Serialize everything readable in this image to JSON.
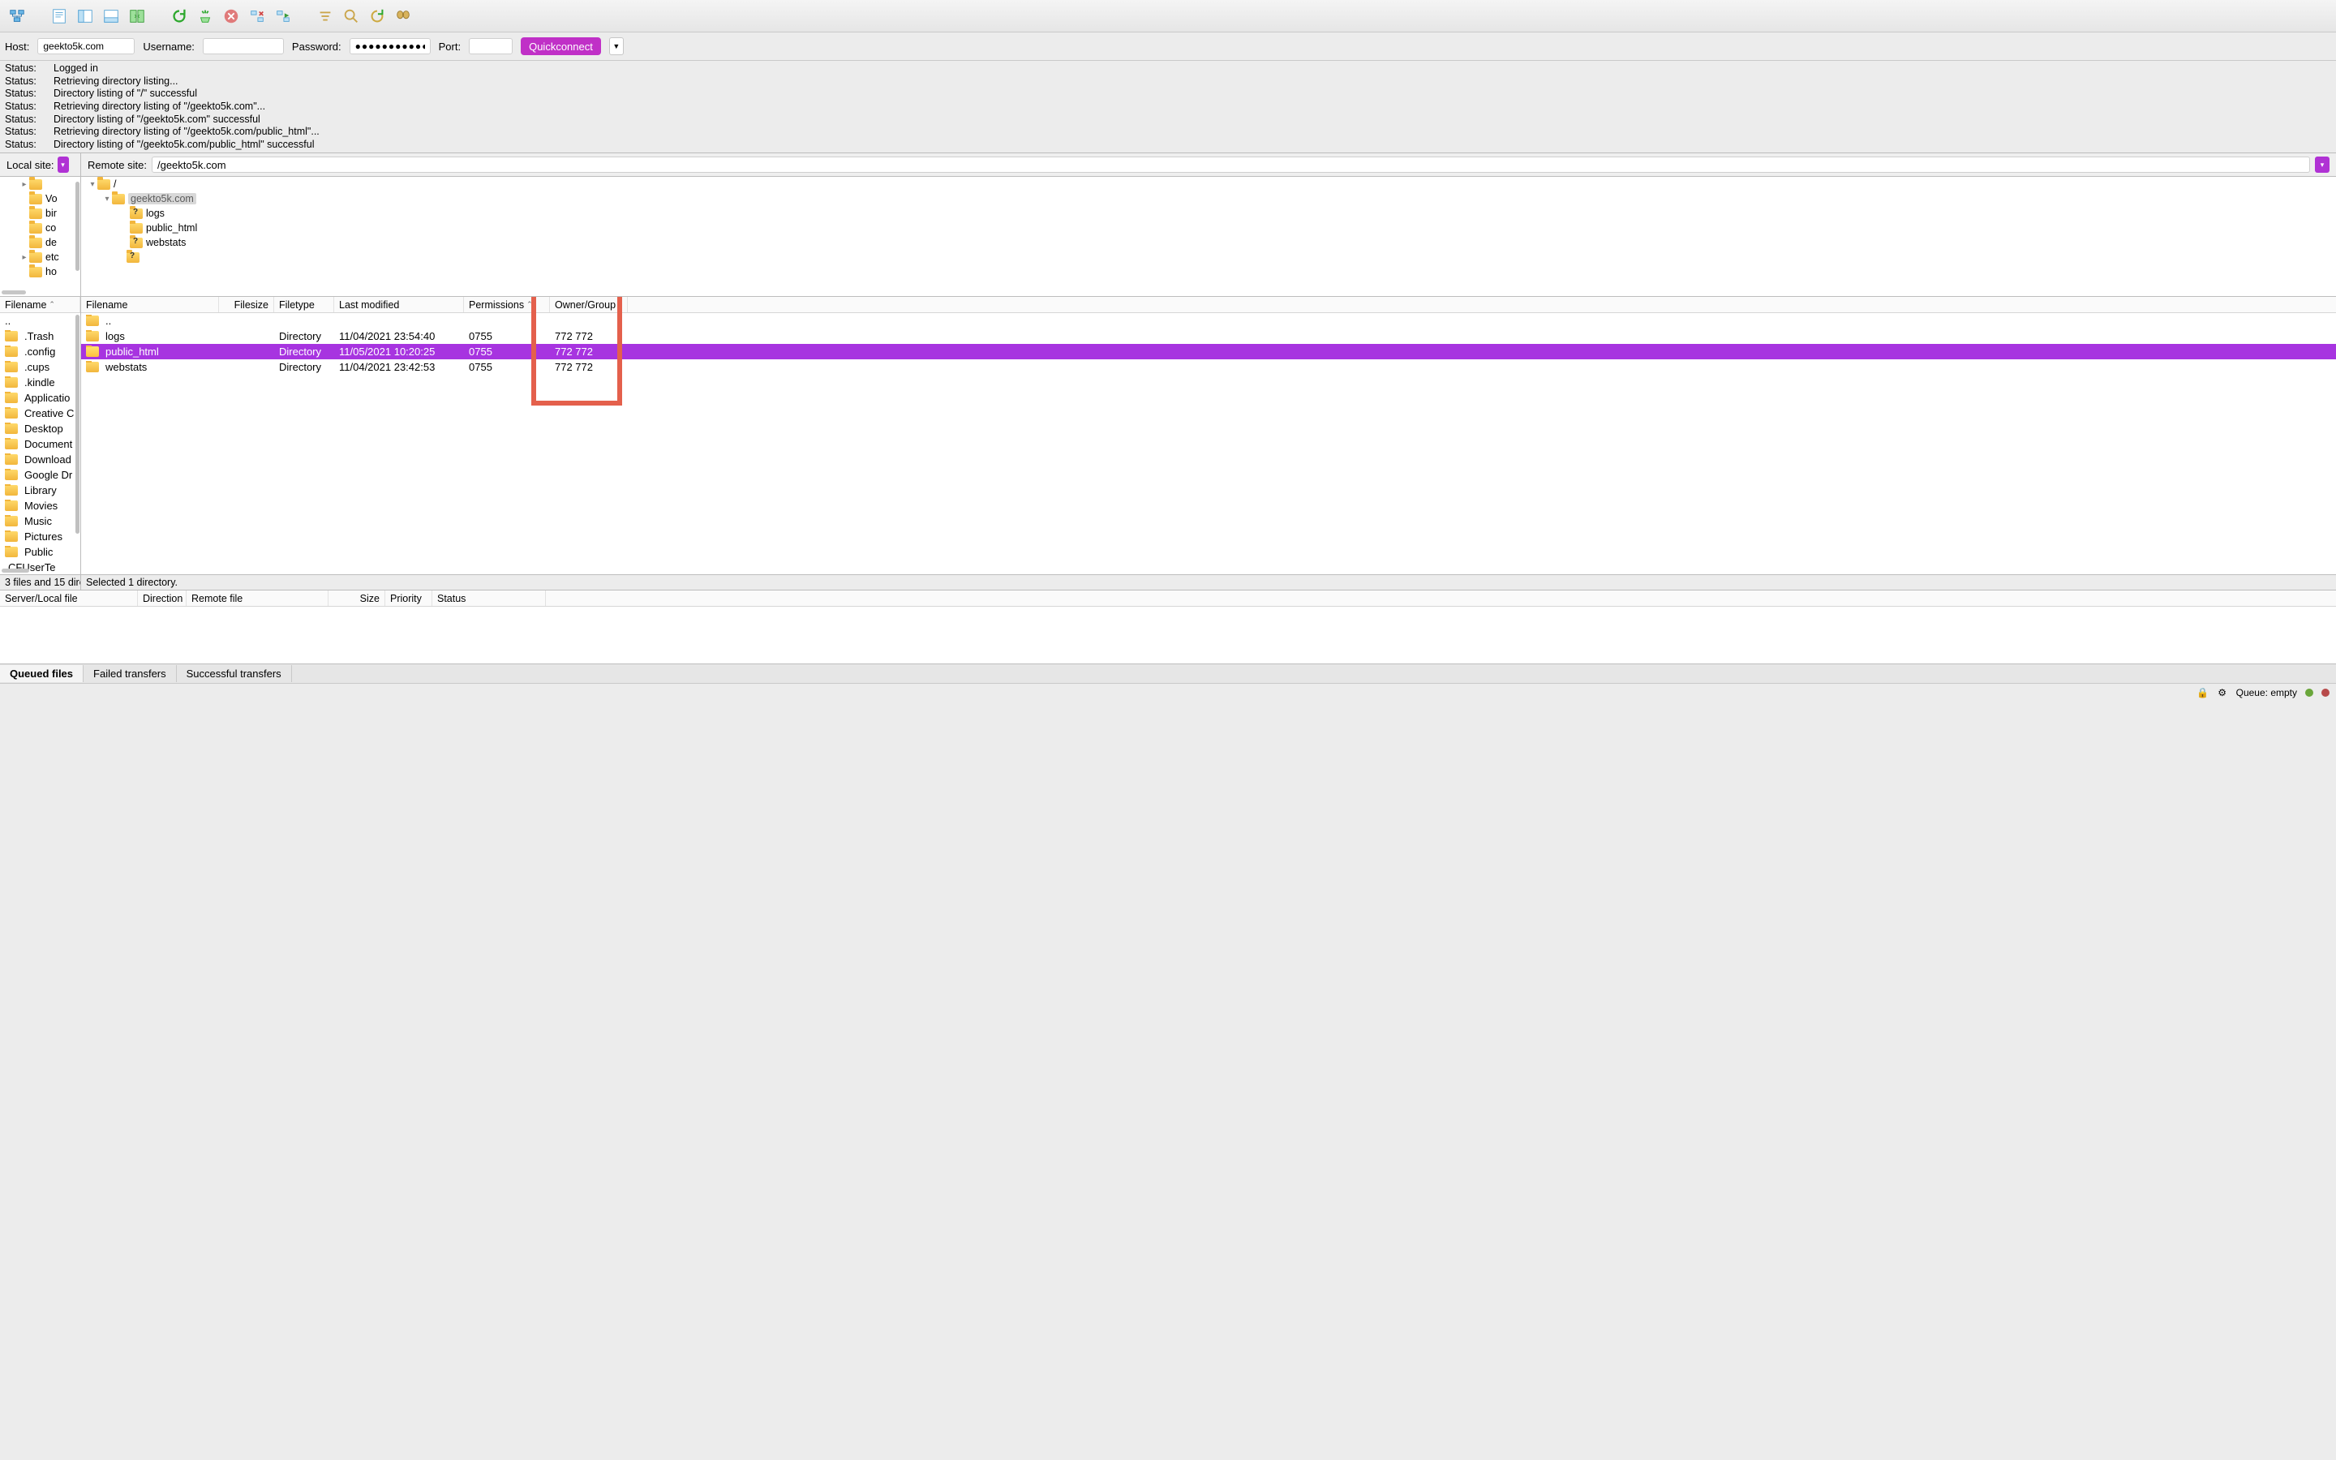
{
  "connectbar": {
    "host_label": "Host:",
    "host_value": "geekto5k.com",
    "user_label": "Username:",
    "user_value": "",
    "pass_label": "Password:",
    "pass_value": "●●●●●●●●●●●",
    "port_label": "Port:",
    "port_value": "",
    "button": "Quickconnect"
  },
  "log": [
    {
      "label": "Status:",
      "msg": "Logged in"
    },
    {
      "label": "Status:",
      "msg": "Retrieving directory listing..."
    },
    {
      "label": "Status:",
      "msg": "Directory listing of \"/\" successful"
    },
    {
      "label": "Status:",
      "msg": "Retrieving directory listing of \"/geekto5k.com\"..."
    },
    {
      "label": "Status:",
      "msg": "Directory listing of \"/geekto5k.com\" successful"
    },
    {
      "label": "Status:",
      "msg": "Retrieving directory listing of \"/geekto5k.com/public_html\"..."
    },
    {
      "label": "Status:",
      "msg": "Directory listing of \"/geekto5k.com/public_html\" successful"
    }
  ],
  "sitebar": {
    "local_label": "Local site:",
    "remote_label": "Remote site:",
    "remote_path": "/geekto5k.com"
  },
  "local_tree": [
    {
      "indent": 24,
      "tw": "▸",
      "name": ""
    },
    {
      "indent": 24,
      "tw": "",
      "name": "Vo"
    },
    {
      "indent": 24,
      "tw": "",
      "name": "bir"
    },
    {
      "indent": 24,
      "tw": "",
      "name": "co"
    },
    {
      "indent": 24,
      "tw": "",
      "name": "de"
    },
    {
      "indent": 24,
      "tw": "▸",
      "name": "etc"
    },
    {
      "indent": 24,
      "tw": "",
      "name": "ho"
    }
  ],
  "remote_tree": [
    {
      "indent": 8,
      "tw": "▾",
      "q": false,
      "name": "/"
    },
    {
      "indent": 26,
      "tw": "▾",
      "q": false,
      "name": "geekto5k.com",
      "sel": true
    },
    {
      "indent": 48,
      "tw": "",
      "q": true,
      "name": "logs"
    },
    {
      "indent": 48,
      "tw": "",
      "q": false,
      "name": "public_html"
    },
    {
      "indent": 48,
      "tw": "",
      "q": true,
      "name": "webstats"
    },
    {
      "indent": 44,
      "tw": "",
      "q": true,
      "name": ""
    }
  ],
  "local_header": {
    "filename": "Filename"
  },
  "local_files": [
    "..",
    ".Trash",
    ".config",
    ".cups",
    ".kindle",
    "Applicatio",
    "Creative C",
    "Desktop",
    "Document",
    "Download",
    "Google Dr",
    "Library",
    "Movies",
    "Music",
    "Pictures",
    "Public",
    "CFUserTe"
  ],
  "remote_header": {
    "filename": "Filename",
    "filesize": "Filesize",
    "filetype": "Filetype",
    "lastmod": "Last modified",
    "perm": "Permissions",
    "owner": "Owner/Group"
  },
  "remote_files": [
    {
      "name": "..",
      "size": "",
      "type": "",
      "mod": "",
      "perm": "",
      "own": "",
      "sel": false
    },
    {
      "name": "logs",
      "size": "",
      "type": "Directory",
      "mod": "11/04/2021 23:54:40",
      "perm": "0755",
      "own": "772 772",
      "sel": false
    },
    {
      "name": "public_html",
      "size": "",
      "type": "Directory",
      "mod": "11/05/2021 10:20:25",
      "perm": "0755",
      "own": "772 772",
      "sel": true
    },
    {
      "name": "webstats",
      "size": "",
      "type": "Directory",
      "mod": "11/04/2021 23:42:53",
      "perm": "0755",
      "own": "772 772",
      "sel": false
    }
  ],
  "status": {
    "local": "3 files and 15 dire",
    "remote": "Selected 1 directory."
  },
  "queue_header": {
    "server": "Server/Local file",
    "direction": "Direction",
    "remote": "Remote file",
    "size": "Size",
    "priority": "Priority",
    "status": "Status"
  },
  "tabs": {
    "queued": "Queued files",
    "failed": "Failed transfers",
    "success": "Successful transfers"
  },
  "footer": {
    "queue": "Queue: empty"
  }
}
